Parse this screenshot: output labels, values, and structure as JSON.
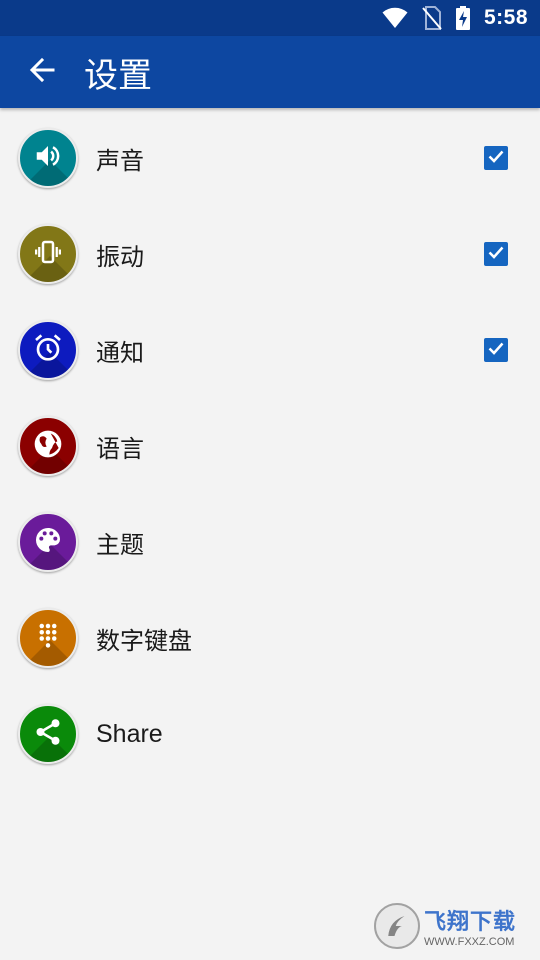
{
  "status_bar": {
    "time": "5:58"
  },
  "header": {
    "title": "设置"
  },
  "settings": [
    {
      "label": "声音",
      "icon": "volume-icon",
      "color": "#00838f",
      "checked": true
    },
    {
      "label": "振动",
      "icon": "vibration-icon",
      "color": "#827717",
      "checked": true
    },
    {
      "label": "通知",
      "icon": "alarm-clock-icon",
      "color": "#0d1bbf",
      "checked": true
    },
    {
      "label": "语言",
      "icon": "globe-icon",
      "color": "#8b0000"
    },
    {
      "label": "主题",
      "icon": "palette-icon",
      "color": "#6a1b9a"
    },
    {
      "label": "数字键盘",
      "icon": "dialpad-icon",
      "color": "#c87000"
    },
    {
      "label": "Share",
      "icon": "share-icon",
      "color": "#0a8a0a"
    }
  ],
  "colors": {
    "status_bar": "#0a3a8a",
    "app_bar": "#0d47a1",
    "checkbox": "#1565c0",
    "background": "#f3f3f3"
  },
  "watermark": {
    "name": "飞翔下载",
    "url": "WWW.FXXZ.COM"
  }
}
